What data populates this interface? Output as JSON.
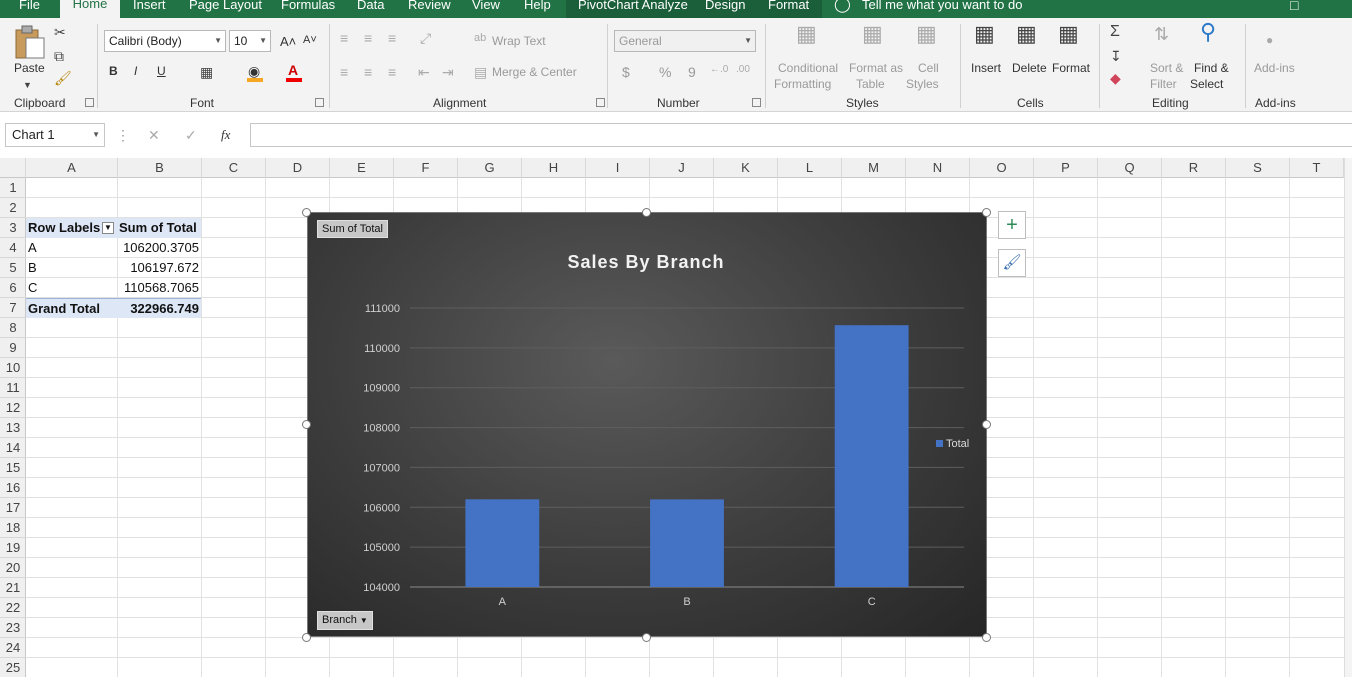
{
  "menu": {
    "tabs": [
      "File",
      "Home",
      "Insert",
      "Page Layout",
      "Formulas",
      "Data",
      "Review",
      "View",
      "Help",
      "PivotChart Analyze",
      "Design",
      "Format"
    ],
    "tell_me": "Tell me what you want to do"
  },
  "ribbon": {
    "clipboard": {
      "paste": "Paste",
      "label": "Clipboard"
    },
    "font": {
      "name": "Calibri (Body)",
      "size": "10",
      "bold": "B",
      "italic": "I",
      "underline": "U",
      "grow": "A˄",
      "shrink": "A˅",
      "label": "Font"
    },
    "alignment": {
      "wrap": "Wrap Text",
      "merge": "Merge & Center",
      "label": "Alignment"
    },
    "number": {
      "format": "General",
      "currency": "$",
      "percent": "%",
      "comma": "9",
      "inc_dec": "←.0\n.00",
      "dec_dec": ".00\n→.0",
      "label": "Number"
    },
    "styles": {
      "cond1": "Conditional",
      "cond2": "Formatting",
      "tbl1": "Format as",
      "tbl2": "Table",
      "cell1": "Cell",
      "cell2": "Styles",
      "label": "Styles"
    },
    "cells": {
      "insert": "Insert",
      "delete": "Delete",
      "format": "Format",
      "label": "Cells"
    },
    "editing": {
      "sort1": "Sort &",
      "sort2": "Filter",
      "find1": "Find &",
      "find2": "Select",
      "label": "Editing"
    },
    "addins": {
      "btn": "Add-ins",
      "label": "Add-ins"
    }
  },
  "formula_bar": {
    "name_box": "Chart 1",
    "fx": "fx",
    "value": ""
  },
  "columns": [
    "A",
    "B",
    "C",
    "D",
    "E",
    "F",
    "G",
    "H",
    "I",
    "J",
    "K",
    "L",
    "M",
    "N",
    "O",
    "P",
    "Q",
    "R",
    "S",
    "T"
  ],
  "rows": [
    "1",
    "2",
    "3",
    "4",
    "5",
    "6",
    "7",
    "8",
    "9",
    "10",
    "11",
    "12",
    "13",
    "14",
    "15",
    "16",
    "17",
    "18",
    "19",
    "20",
    "21",
    "22",
    "23",
    "24",
    "25"
  ],
  "pivot": {
    "header_row_labels": "Row Labels",
    "header_sum": "Sum of Total",
    "rows": [
      {
        "label": "A",
        "value": "106200.3705"
      },
      {
        "label": "B",
        "value": "106197.672"
      },
      {
        "label": "C",
        "value": "110568.7065"
      }
    ],
    "grand_label": "Grand Total",
    "grand_value": "322966.749"
  },
  "chart_buttons": {
    "field_value": "Sum of Total",
    "field_axis": "Branch"
  },
  "chart_data": {
    "type": "bar",
    "title": "Sales By Branch",
    "categories": [
      "A",
      "B",
      "C"
    ],
    "series": [
      {
        "name": "Total",
        "values": [
          106200.3705,
          106197.672,
          110568.7065
        ],
        "color": "#4472c4"
      }
    ],
    "ylim": [
      104000,
      111000
    ],
    "yticks": [
      104000,
      105000,
      106000,
      107000,
      108000,
      109000,
      110000,
      111000
    ],
    "grid": true,
    "legend_position": "right",
    "xlabel": "",
    "ylabel": ""
  },
  "colors": {
    "excel_green": "#217346",
    "bar": "#4472c4",
    "pivot_header": "#dde7f6"
  }
}
